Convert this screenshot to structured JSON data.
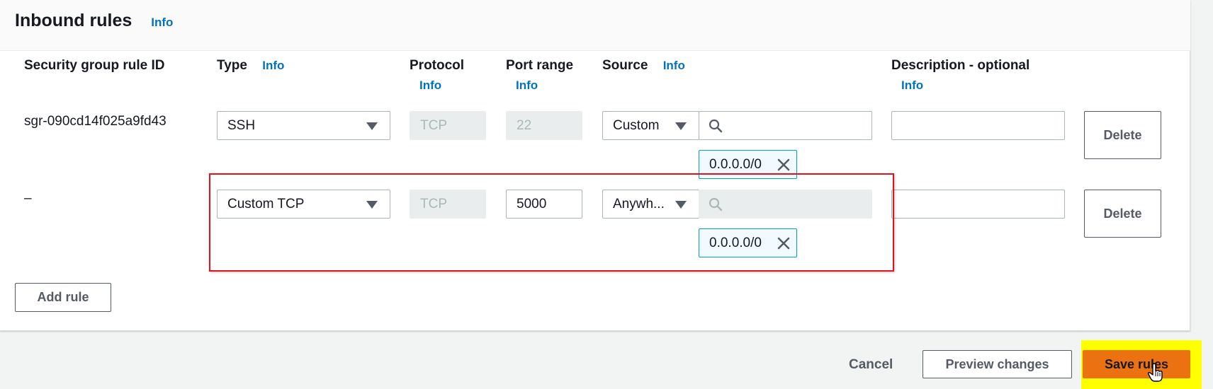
{
  "panel": {
    "title": "Inbound rules",
    "info": "Info"
  },
  "columns": {
    "rule_id": "Security group rule ID",
    "type": "Type",
    "type_info": "Info",
    "protocol": "Protocol",
    "protocol_info": "Info",
    "port_range": "Port range",
    "port_range_info": "Info",
    "source": "Source",
    "source_info": "Info",
    "description": "Description - optional",
    "description_info": "Info"
  },
  "rules": [
    {
      "rule_id": "sgr-090cd14f025a9fd43",
      "type": "SSH",
      "protocol": "TCP",
      "port_range": "22",
      "source_type": "Custom",
      "source_search": "",
      "cidr_token": "0.0.0.0/0",
      "description": "",
      "delete_label": "Delete"
    },
    {
      "rule_id": "–",
      "type": "Custom TCP",
      "protocol": "TCP",
      "port_range": "5000",
      "source_type": "Anywh...",
      "source_search": "",
      "cidr_token": "0.0.0.0/0",
      "description": "",
      "delete_label": "Delete"
    }
  ],
  "actions": {
    "add_rule": "Add rule",
    "cancel": "Cancel",
    "preview_changes": "Preview changes",
    "save_rules": "Save rules"
  },
  "colors": {
    "primary": "#ec7211",
    "link": "#0073bb",
    "highlight_box": "#e0141e",
    "highlight_bg": "#ffff00",
    "token_border": "#00a1c9"
  },
  "icons": {
    "select_caret": "caret-down-icon",
    "search": "search-icon",
    "remove_token": "close-icon",
    "cursor": "hand-pointer-icon"
  }
}
